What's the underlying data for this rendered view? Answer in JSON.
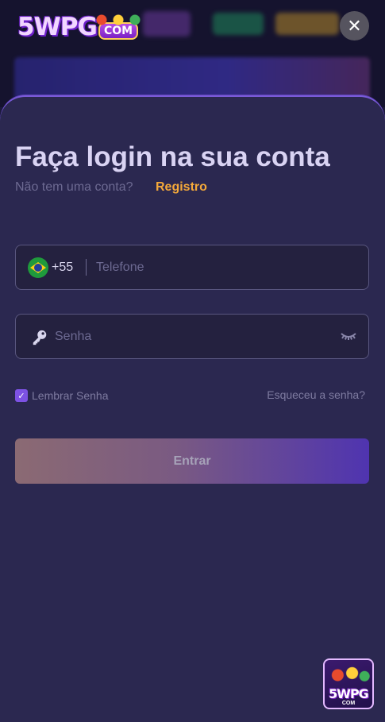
{
  "brand": {
    "logo_main": "5WPG",
    "logo_suffix": "COM"
  },
  "header": {
    "close_icon": "close-icon",
    "close_glyph": "✕"
  },
  "login": {
    "title": "Faça login na sua conta",
    "no_account_text": "Não tem uma conta?",
    "register_label": "Registro",
    "phone": {
      "country_icon": "brazil-flag-icon",
      "dial_code": "+55",
      "value": "",
      "placeholder": "Telefone"
    },
    "password": {
      "lock_icon": "key-icon",
      "toggle_icon": "eye-closed-icon",
      "value": "",
      "placeholder": "Senha"
    },
    "remember": {
      "label": "Lembrar Senha",
      "checked": true
    },
    "forgot_label": "Esqueceu a senha?",
    "submit_label": "Entrar"
  },
  "floating_widget": {
    "icon": "5wpg-app-icon"
  },
  "colors": {
    "sheet_background": "#2b2850",
    "accent_link": "#f5a93a",
    "checkbox": "#7d52e4",
    "submit_gradient_start": "#8b6a73",
    "submit_gradient_end": "#4f34b0"
  }
}
